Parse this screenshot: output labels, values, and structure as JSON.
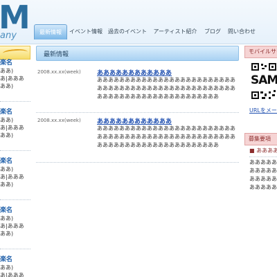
{
  "header": {
    "logo_letter": "M",
    "logo_sub": "any",
    "nav": [
      {
        "label": "最新情報",
        "active": true
      },
      {
        "label": "イベント情報",
        "active": false
      },
      {
        "label": "過去のイベント",
        "active": false
      },
      {
        "label": "アーティスト紹介",
        "active": false
      },
      {
        "label": "ブログ",
        "active": false
      },
      {
        "label": "問い合わせ",
        "active": false
      }
    ]
  },
  "left": {
    "artists": [
      {
        "name": "楽名",
        "lines": [
          "ああ)",
          "あ|あああ",
          "ああ)"
        ]
      },
      {
        "name": "楽名",
        "lines": [
          "ああ)",
          "あ|あああ",
          "ああ)"
        ]
      },
      {
        "name": "楽名",
        "lines": [
          "ああ)",
          "あ|あああ",
          "ああ)"
        ]
      },
      {
        "name": "楽名",
        "lines": [
          "ああ)",
          "あ|あああ",
          "ああ)"
        ]
      },
      {
        "name": "楽名",
        "lines": [
          "ああ)",
          "あ|あああ",
          "ああ)"
        ]
      }
    ]
  },
  "main": {
    "section_title": "最新情報",
    "news": [
      {
        "date": "2008.xx.xx(week)",
        "title": "ああああああああああああ",
        "body": "ああああああああああああああああああああああああああああああああああああああああああああああああああああああああああああああああああああああああ"
      },
      {
        "date": "2008.xx.xx(week)",
        "title": "ああああああああああああ",
        "body": "ああああああああああああああああああああああああああああああああああああああああああああああああああああああああああああああああああああああああ"
      }
    ]
  },
  "right": {
    "mobile_title": "モバイルサイト",
    "qr_text": "SAMP",
    "qr_link": "URLをメールで送る",
    "recruit_title": "募集要項",
    "recruit_head": "■ あああああ",
    "recruit_lines": [
      "あああああ",
      "あああああ",
      "あああああ",
      "あああああ"
    ]
  }
}
